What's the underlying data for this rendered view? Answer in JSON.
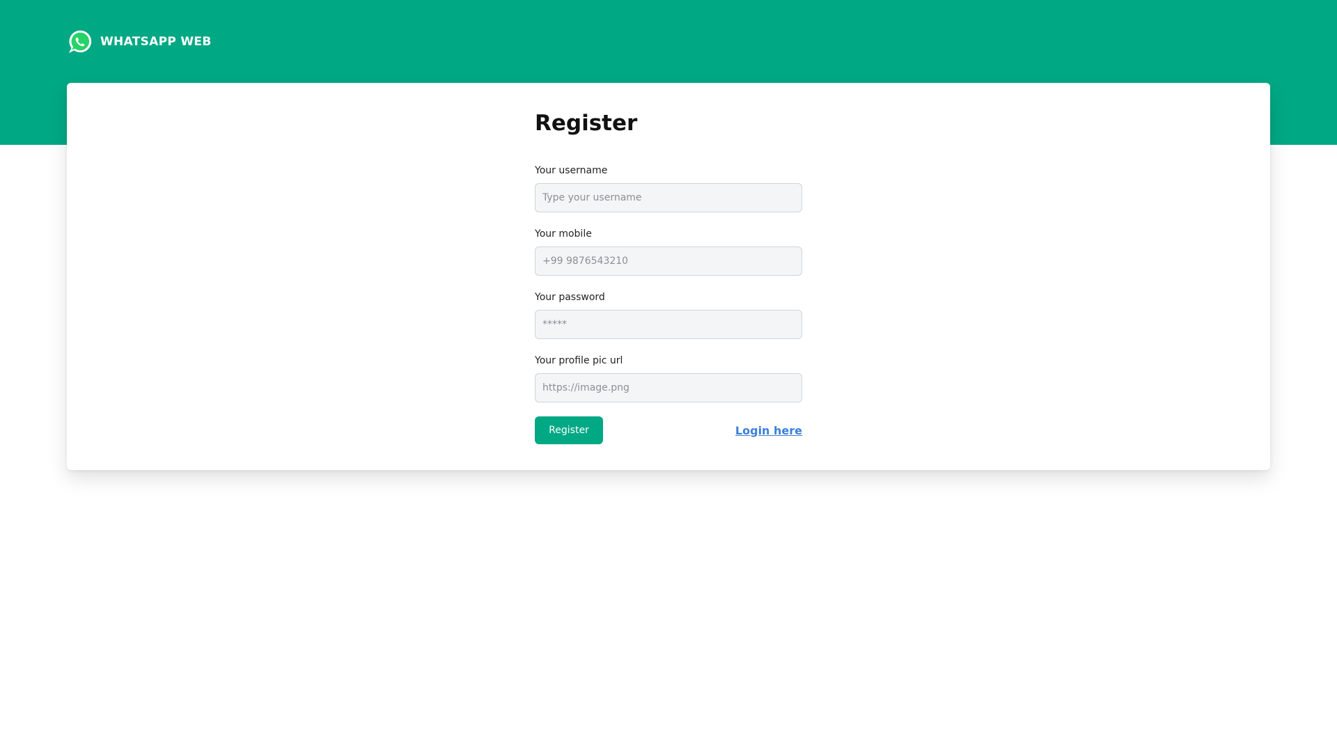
{
  "header": {
    "brand_name": "WHATSAPP WEB",
    "logo_icon": "whatsapp-logo-icon",
    "band_color": "#00a884"
  },
  "form": {
    "title": "Register",
    "fields": [
      {
        "label": "Your username",
        "placeholder": "Type your username",
        "value": ""
      },
      {
        "label": "Your mobile",
        "placeholder": "+99 9876543210",
        "value": ""
      },
      {
        "label": "Your password",
        "placeholder": "*****",
        "value": ""
      },
      {
        "label": "Your profile pic url",
        "placeholder": "https://image.png",
        "value": ""
      }
    ],
    "submit_label": "Register",
    "login_link_label": "Login here"
  },
  "colors": {
    "accent": "#00a884",
    "link": "#3b7fd9"
  }
}
